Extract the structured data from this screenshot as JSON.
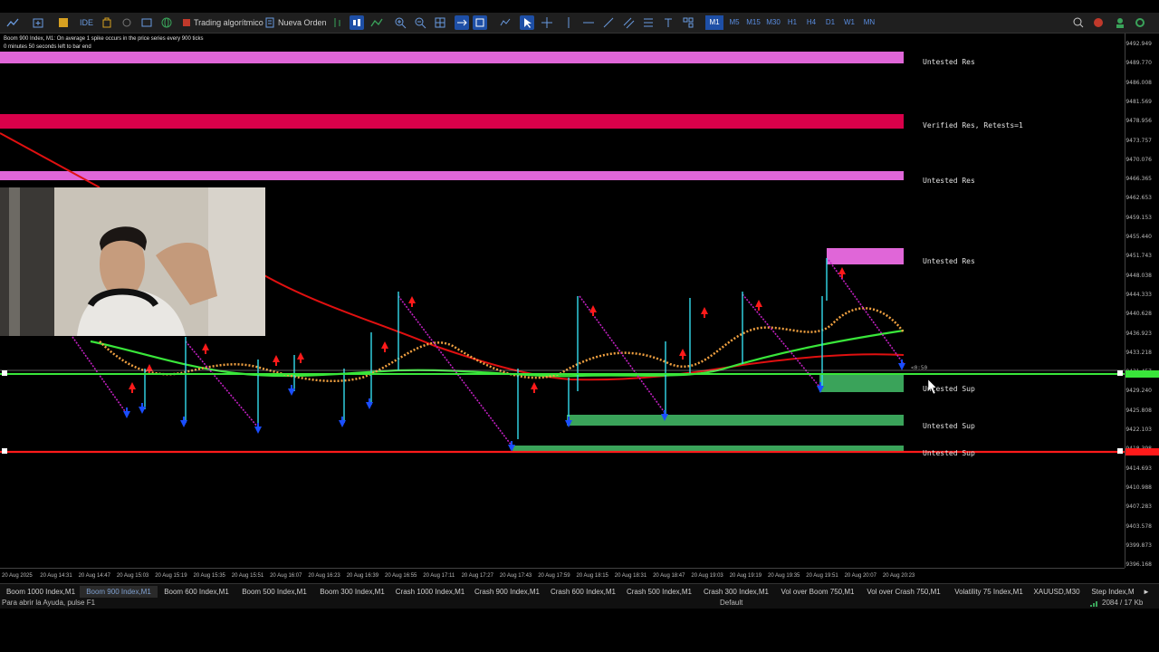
{
  "toolbar": {
    "algo_label": "Trading algorítmico",
    "new_order_label": "Nueva Orden",
    "ide_label": "IDE",
    "timeframes": [
      "M1",
      "M5",
      "M15",
      "M30",
      "H1",
      "H4",
      "D1",
      "W1",
      "MN"
    ],
    "active_timeframe": "M1"
  },
  "chart": {
    "title": "Boom 900 Index, M1:  On average 1 spike occurs in the price series every 900 ticks",
    "countdown": "0 minutes 50 seconds left to bar end",
    "zones": [
      {
        "label": "Untested Res",
        "color": "#e066d8"
      },
      {
        "label": "Verified Res, Retests=1",
        "color": "#d8004a"
      },
      {
        "label": "Untested Res",
        "color": "#e066d8"
      },
      {
        "label": "Untested Res",
        "color": "#e066d8"
      },
      {
        "label": "Untested Sup",
        "color": "#3aa35a"
      },
      {
        "label": "Untested Sup",
        "color": "#3aa35a"
      },
      {
        "label": "Untested Sup",
        "color": "#3aa35a"
      }
    ],
    "bid_marker": "<0:50",
    "price_labels": [
      "9492.949",
      "9489.770",
      "9486.008",
      "9481.569",
      "9478.956",
      "9473.757",
      "9470.076",
      "9466.365",
      "9462.653",
      "9459.153",
      "9455.440",
      "9451.743",
      "9448.038",
      "9444.333",
      "9440.628",
      "9436.923",
      "9433.218",
      "9431.457",
      "9429.240",
      "9425.808",
      "9422.103",
      "9418.398",
      "9414.693",
      "9410.988",
      "9407.283",
      "9403.578",
      "9399.873",
      "9396.168"
    ],
    "time_labels": [
      "20 Aug 2025",
      "20 Aug 14:31",
      "20 Aug 14:47",
      "20 Aug 15:03",
      "20 Aug 15:19",
      "20 Aug 15:35",
      "20 Aug 15:51",
      "20 Aug 16:07",
      "20 Aug 16:23",
      "20 Aug 16:39",
      "20 Aug 16:55",
      "20 Aug 17:11",
      "20 Aug 17:27",
      "20 Aug 17:43",
      "20 Aug 17:59",
      "20 Aug 18:15",
      "20 Aug 18:31",
      "20 Aug 18:47",
      "20 Aug 19:03",
      "20 Aug 19:19",
      "20 Aug 19:35",
      "20 Aug 19:51",
      "20 Aug 20:07",
      "20 Aug 20:23"
    ]
  },
  "tabs": [
    "Boom 1000 Index,M1",
    "Boom 900 Index,M1",
    "Boom 600 Index,M1",
    "Boom 500 Index,M1",
    "Boom 300 Index,M1",
    "Crash 1000 Index,M1",
    "Crash 900 Index,M1",
    "Crash 600 Index,M1",
    "Crash 500 Index,M1",
    "Crash 300 Index,M1",
    "Vol over Boom 750,M1",
    "Vol over Crash 750,M1",
    "Volatility 75 Index,M1",
    "XAUUSD,M30",
    "Step Index,M"
  ],
  "active_tab": "Boom 900 Index,M1",
  "status": {
    "help": "Para abrir la Ayuda, pulse F1",
    "profile": "Default",
    "traffic": "2084 / 17 Kb"
  }
}
